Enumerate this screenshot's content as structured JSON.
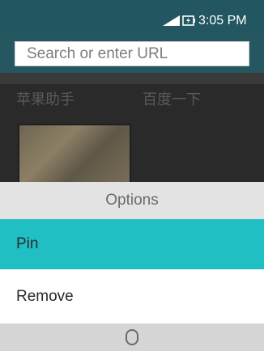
{
  "status_bar": {
    "time": "3:05 PM",
    "signal_icon": "signal-strength-icon",
    "battery_icon": "battery-charging-icon"
  },
  "address_bar": {
    "placeholder": "Search or enter URL"
  },
  "background_tiles": [
    {
      "label": "苹果助手"
    },
    {
      "label": "百度一下"
    }
  ],
  "options_menu": {
    "title": "Options",
    "items": [
      {
        "label": "Pin",
        "selected": true
      },
      {
        "label": "Remove",
        "selected": false
      }
    ]
  },
  "softkeys": {
    "center_icon": "select-ring-icon"
  },
  "colors": {
    "status_bar": "#225660",
    "highlight": "#1fbfc3",
    "header": "#e3e3e3",
    "softkey_bar": "#d5d5d5"
  }
}
